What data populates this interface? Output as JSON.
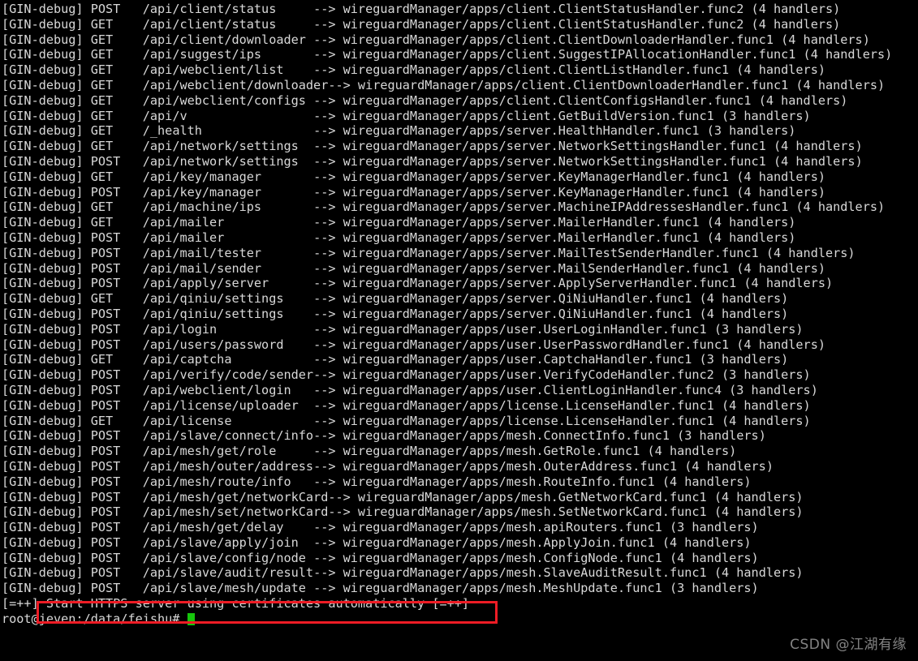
{
  "terminal": {
    "background_color": "#000000",
    "foreground_color": "#d8d8d8",
    "cursor_color": "#16c60c",
    "highlight_box_color": "#ee1c25",
    "prompt": "root@jeven:/data/feishu# ",
    "start_line_prefix": "[=++] ",
    "start_line_message": "Start HTTPS server using certificates automatically [=++]",
    "watermark": "CSDN @江湖有缘"
  },
  "routes": [
    {
      "tag": "[GIN-debug]",
      "method": "POST",
      "path": "/api/client/status",
      "arrow": "-->",
      "handler": "wireguardManager/apps/client.ClientStatusHandler.func2",
      "handlers": "(4 handlers)"
    },
    {
      "tag": "[GIN-debug]",
      "method": "GET",
      "path": "/api/client/status",
      "arrow": "-->",
      "handler": "wireguardManager/apps/client.ClientStatusHandler.func2",
      "handlers": "(4 handlers)"
    },
    {
      "tag": "[GIN-debug]",
      "method": "GET",
      "path": "/api/client/downloader",
      "arrow": "-->",
      "handler": "wireguardManager/apps/client.ClientDownloaderHandler.func1",
      "handlers": "(4 handlers)"
    },
    {
      "tag": "[GIN-debug]",
      "method": "GET",
      "path": "/api/suggest/ips",
      "arrow": "-->",
      "handler": "wireguardManager/apps/client.SuggestIPAllocationHandler.func1",
      "handlers": "(4 handlers)"
    },
    {
      "tag": "[GIN-debug]",
      "method": "GET",
      "path": "/api/webclient/list",
      "arrow": "-->",
      "handler": "wireguardManager/apps/client.ClientListHandler.func1",
      "handlers": "(4 handlers)"
    },
    {
      "tag": "[GIN-debug]",
      "method": "GET",
      "path": "/api/webclient/downloader",
      "arrow": "-->",
      "handler": "wireguardManager/apps/client.ClientDownloaderHandler.func1",
      "handlers": "(4 handlers)"
    },
    {
      "tag": "[GIN-debug]",
      "method": "GET",
      "path": "/api/webclient/configs",
      "arrow": "-->",
      "handler": "wireguardManager/apps/client.ClientConfigsHandler.func1",
      "handlers": "(4 handlers)"
    },
    {
      "tag": "[GIN-debug]",
      "method": "GET",
      "path": "/api/v",
      "arrow": "-->",
      "handler": "wireguardManager/apps/client.GetBuildVersion.func1",
      "handlers": "(3 handlers)"
    },
    {
      "tag": "[GIN-debug]",
      "method": "GET",
      "path": "/_health",
      "arrow": "-->",
      "handler": "wireguardManager/apps/server.HealthHandler.func1",
      "handlers": "(3 handlers)"
    },
    {
      "tag": "[GIN-debug]",
      "method": "GET",
      "path": "/api/network/settings",
      "arrow": "-->",
      "handler": "wireguardManager/apps/server.NetworkSettingsHandler.func1",
      "handlers": "(4 handlers)"
    },
    {
      "tag": "[GIN-debug]",
      "method": "POST",
      "path": "/api/network/settings",
      "arrow": "-->",
      "handler": "wireguardManager/apps/server.NetworkSettingsHandler.func1",
      "handlers": "(4 handlers)"
    },
    {
      "tag": "[GIN-debug]",
      "method": "GET",
      "path": "/api/key/manager",
      "arrow": "-->",
      "handler": "wireguardManager/apps/server.KeyManagerHandler.func1",
      "handlers": "(4 handlers)"
    },
    {
      "tag": "[GIN-debug]",
      "method": "POST",
      "path": "/api/key/manager",
      "arrow": "-->",
      "handler": "wireguardManager/apps/server.KeyManagerHandler.func1",
      "handlers": "(4 handlers)"
    },
    {
      "tag": "[GIN-debug]",
      "method": "GET",
      "path": "/api/machine/ips",
      "arrow": "-->",
      "handler": "wireguardManager/apps/server.MachineIPAddressesHandler.func1",
      "handlers": "(4 handlers)"
    },
    {
      "tag": "[GIN-debug]",
      "method": "GET",
      "path": "/api/mailer",
      "arrow": "-->",
      "handler": "wireguardManager/apps/server.MailerHandler.func1",
      "handlers": "(4 handlers)"
    },
    {
      "tag": "[GIN-debug]",
      "method": "POST",
      "path": "/api/mailer",
      "arrow": "-->",
      "handler": "wireguardManager/apps/server.MailerHandler.func1",
      "handlers": "(4 handlers)"
    },
    {
      "tag": "[GIN-debug]",
      "method": "POST",
      "path": "/api/mail/tester",
      "arrow": "-->",
      "handler": "wireguardManager/apps/server.MailTestSenderHandler.func1",
      "handlers": "(4 handlers)"
    },
    {
      "tag": "[GIN-debug]",
      "method": "POST",
      "path": "/api/mail/sender",
      "arrow": "-->",
      "handler": "wireguardManager/apps/server.MailSenderHandler.func1",
      "handlers": "(4 handlers)"
    },
    {
      "tag": "[GIN-debug]",
      "method": "POST",
      "path": "/api/apply/server",
      "arrow": "-->",
      "handler": "wireguardManager/apps/server.ApplyServerHandler.func1",
      "handlers": "(4 handlers)"
    },
    {
      "tag": "[GIN-debug]",
      "method": "GET",
      "path": "/api/qiniu/settings",
      "arrow": "-->",
      "handler": "wireguardManager/apps/server.QiNiuHandler.func1",
      "handlers": "(4 handlers)"
    },
    {
      "tag": "[GIN-debug]",
      "method": "POST",
      "path": "/api/qiniu/settings",
      "arrow": "-->",
      "handler": "wireguardManager/apps/server.QiNiuHandler.func1",
      "handlers": "(4 handlers)"
    },
    {
      "tag": "[GIN-debug]",
      "method": "POST",
      "path": "/api/login",
      "arrow": "-->",
      "handler": "wireguardManager/apps/user.UserLoginHandler.func1",
      "handlers": "(3 handlers)"
    },
    {
      "tag": "[GIN-debug]",
      "method": "POST",
      "path": "/api/users/password",
      "arrow": "-->",
      "handler": "wireguardManager/apps/user.UserPasswordHandler.func1",
      "handlers": "(4 handlers)"
    },
    {
      "tag": "[GIN-debug]",
      "method": "GET",
      "path": "/api/captcha",
      "arrow": "-->",
      "handler": "wireguardManager/apps/user.CaptchaHandler.func1",
      "handlers": "(3 handlers)"
    },
    {
      "tag": "[GIN-debug]",
      "method": "POST",
      "path": "/api/verify/code/sender",
      "arrow": "-->",
      "handler": "wireguardManager/apps/user.VerifyCodeHandler.func2",
      "handlers": "(3 handlers)"
    },
    {
      "tag": "[GIN-debug]",
      "method": "POST",
      "path": "/api/webclient/login",
      "arrow": "-->",
      "handler": "wireguardManager/apps/user.ClientLoginHandler.func4",
      "handlers": "(3 handlers)"
    },
    {
      "tag": "[GIN-debug]",
      "method": "POST",
      "path": "/api/license/uploader",
      "arrow": "-->",
      "handler": "wireguardManager/apps/license.LicenseHandler.func1",
      "handlers": "(4 handlers)"
    },
    {
      "tag": "[GIN-debug]",
      "method": "GET",
      "path": "/api/license",
      "arrow": "-->",
      "handler": "wireguardManager/apps/license.LicenseHandler.func1",
      "handlers": "(4 handlers)"
    },
    {
      "tag": "[GIN-debug]",
      "method": "POST",
      "path": "/api/slave/connect/info",
      "arrow": "-->",
      "handler": "wireguardManager/apps/mesh.ConnectInfo.func1",
      "handlers": "(3 handlers)"
    },
    {
      "tag": "[GIN-debug]",
      "method": "POST",
      "path": "/api/mesh/get/role",
      "arrow": "-->",
      "handler": "wireguardManager/apps/mesh.GetRole.func1",
      "handlers": "(4 handlers)"
    },
    {
      "tag": "[GIN-debug]",
      "method": "POST",
      "path": "/api/mesh/outer/address",
      "arrow": "-->",
      "handler": "wireguardManager/apps/mesh.OuterAddress.func1",
      "handlers": "(4 handlers)"
    },
    {
      "tag": "[GIN-debug]",
      "method": "POST",
      "path": "/api/mesh/route/info",
      "arrow": "-->",
      "handler": "wireguardManager/apps/mesh.RouteInfo.func1",
      "handlers": "(4 handlers)"
    },
    {
      "tag": "[GIN-debug]",
      "method": "POST",
      "path": "/api/mesh/get/networkCard",
      "arrow": "-->",
      "handler": "wireguardManager/apps/mesh.GetNetworkCard.func1",
      "handlers": "(4 handlers)"
    },
    {
      "tag": "[GIN-debug]",
      "method": "POST",
      "path": "/api/mesh/set/networkCard",
      "arrow": "-->",
      "handler": "wireguardManager/apps/mesh.SetNetworkCard.func1",
      "handlers": "(4 handlers)"
    },
    {
      "tag": "[GIN-debug]",
      "method": "POST",
      "path": "/api/mesh/get/delay",
      "arrow": "-->",
      "handler": "wireguardManager/apps/mesh.apiRouters.func1",
      "handlers": "(3 handlers)"
    },
    {
      "tag": "[GIN-debug]",
      "method": "POST",
      "path": "/api/slave/apply/join",
      "arrow": "-->",
      "handler": "wireguardManager/apps/mesh.ApplyJoin.func1",
      "handlers": "(4 handlers)"
    },
    {
      "tag": "[GIN-debug]",
      "method": "POST",
      "path": "/api/slave/config/node",
      "arrow": "-->",
      "handler": "wireguardManager/apps/mesh.ConfigNode.func1",
      "handlers": "(4 handlers)"
    },
    {
      "tag": "[GIN-debug]",
      "method": "POST",
      "path": "/api/slave/audit/result",
      "arrow": "-->",
      "handler": "wireguardManager/apps/mesh.SlaveAuditResult.func1",
      "handlers": "(4 handlers)"
    },
    {
      "tag": "[GIN-debug]",
      "method": "POST",
      "path": "/api/slave/mesh/update",
      "arrow": "-->",
      "handler": "wireguardManager/apps/mesh.MeshUpdate.func1",
      "handlers": "(3 handlers)"
    }
  ]
}
